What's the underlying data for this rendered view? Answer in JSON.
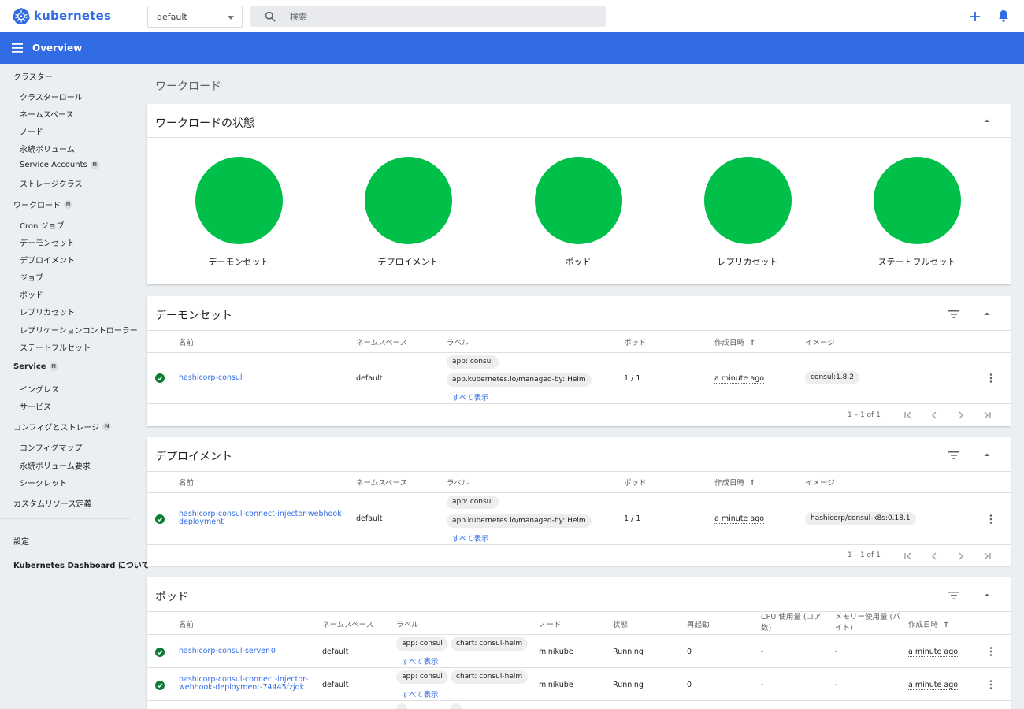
{
  "app": {
    "name": "kubernetes"
  },
  "namespace_select": {
    "value": "default"
  },
  "search": {
    "placeholder": "検索"
  },
  "header": {
    "title": "Overview"
  },
  "sidebar": {
    "cluster": "クラスター",
    "cluster_items": [
      "クラスターロール",
      "ネームスペース",
      "ノード",
      "永続ボリューム",
      "Service Accounts",
      "ストレージクラス"
    ],
    "workloads": "ワークロード",
    "workload_items": [
      "Cron ジョブ",
      "デーモンセット",
      "デプロイメント",
      "ジョブ",
      "ポッド",
      "レプリカセット",
      "レプリケーションコントローラー",
      "ステートフルセット"
    ],
    "service": "Service",
    "service_items": [
      "イングレス",
      "サービス"
    ],
    "config": "コンフィグとストレージ",
    "config_items": [
      "コンフィグマップ",
      "永続ボリューム要求",
      "シークレット"
    ],
    "crd": "カスタムリソース定義",
    "settings": "設定",
    "about": "Kubernetes Dashboard について",
    "badge": "N"
  },
  "content": {
    "title": "ワークロード"
  },
  "workload_status": {
    "title": "ワークロードの状態",
    "items": [
      "デーモンセット",
      "デプロイメント",
      "ポッド",
      "レプリカセット",
      "ステートフルセット"
    ],
    "color": "#00c04a"
  },
  "daemonsets": {
    "title": "デーモンセット",
    "headers": {
      "name": "名前",
      "namespace": "ネームスペース",
      "labels": "ラベル",
      "pods": "ポッド",
      "created": "作成日時",
      "images": "イメージ"
    },
    "rows": [
      {
        "name": "hashicorp-consul",
        "namespace": "default",
        "labels": [
          "app: consul",
          "app.kubernetes.io/managed-by: Helm"
        ],
        "show_all": "すべて表示",
        "pods": "1 / 1",
        "created": "a minute ago",
        "image": "consul:1.8.2"
      }
    ],
    "pager": "1 – 1 of 1"
  },
  "deployments": {
    "title": "デプロイメント",
    "headers": {
      "name": "名前",
      "namespace": "ネームスペース",
      "labels": "ラベル",
      "pods": "ポッド",
      "created": "作成日時",
      "images": "イメージ"
    },
    "rows": [
      {
        "name": "hashicorp-consul-connect-injector-webhook-deployment",
        "name_line1": "hashicorp-consul-connect-injector-webhook-",
        "name_line2": "deployment",
        "namespace": "default",
        "labels": [
          "app: consul",
          "app.kubernetes.io/managed-by: Helm"
        ],
        "show_all": "すべて表示",
        "pods": "1 / 1",
        "created": "a minute ago",
        "image": "hashicorp/consul-k8s:0.18.1"
      }
    ],
    "pager": "1 – 1 of 1"
  },
  "pods": {
    "title": "ポッド",
    "headers": {
      "name": "名前",
      "namespace": "ネームスペース",
      "labels": "ラベル",
      "node": "ノード",
      "status": "状態",
      "restarts": "再起動",
      "cpu_line1": "CPU 使用量 (コア",
      "cpu_line2": "数)",
      "mem_line1": "メモリー使用量 (バ",
      "mem_line2": "イト)",
      "created": "作成日時"
    },
    "rows": [
      {
        "name_line1": "hashicorp-consul-server-0",
        "name_line2": "",
        "namespace": "default",
        "labels": [
          "app: consul",
          "chart: consul-helm"
        ],
        "show_all": "すべて表示",
        "node": "minikube",
        "status": "Running",
        "restarts": "0",
        "cpu": "-",
        "mem": "-",
        "created": "a minute ago"
      },
      {
        "name_line1": "hashicorp-consul-connect-injector-",
        "name_line2": "webhook-deployment-74445fzjdk",
        "namespace": "default",
        "labels": [
          "app: consul",
          "chart: consul-helm"
        ],
        "show_all": "すべて表示",
        "node": "minikube",
        "status": "Running",
        "restarts": "0",
        "cpu": "-",
        "mem": "-",
        "created": "a minute ago"
      }
    ]
  },
  "colors": {
    "primary": "#326ce5",
    "ok": "#00c04a",
    "background": "#eceff1"
  }
}
